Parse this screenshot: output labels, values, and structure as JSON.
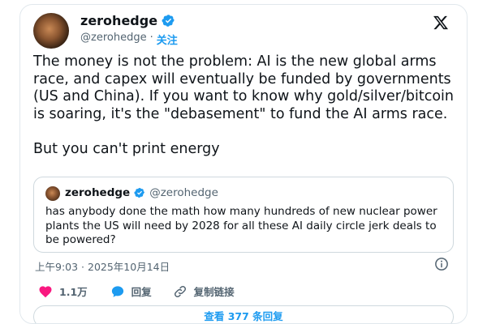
{
  "author": {
    "name": "zerohedge",
    "handle": "@zerohedge",
    "separator": "·",
    "follow_label": "关注"
  },
  "post": {
    "text": "The money is not the problem: AI is the new global arms race, and capex will eventually be funded by governments (US and China). If you want to know why gold/silver/bitcoin is soaring, it's the \"debasement\" to fund the AI arms race.\n\nBut you can't print energy"
  },
  "quoted": {
    "name": "zerohedge",
    "handle": "@zerohedge",
    "text": "has anybody done the math how many hundreds of new nuclear power plants the US will need by 2028 for all these AI daily circle jerk deals to be powered?"
  },
  "meta": {
    "timestamp": "上午9:03 · 2025年10月14日"
  },
  "actions": {
    "likes": "1.1万",
    "reply_label": "回复",
    "copy_link_label": "复制链接"
  },
  "replies_button": "查看 377 条回复",
  "colors": {
    "accent": "#1d9bf0",
    "like": "#f91880",
    "text": "#0f1419",
    "muted": "#536471"
  }
}
